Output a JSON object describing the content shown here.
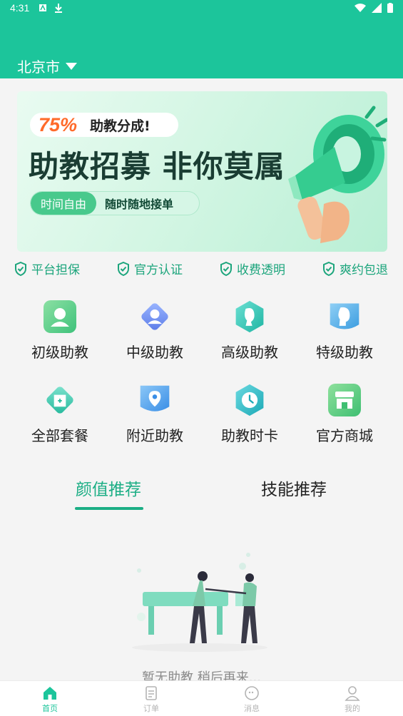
{
  "status_bar": {
    "time": "4:31"
  },
  "header": {
    "city": "北京市"
  },
  "banner": {
    "percent": "75%",
    "subtitle": "助教分成!",
    "title": "助教招募 非你莫属",
    "tag1": "时间自由",
    "tag2": "随时随地接单"
  },
  "guarantees": [
    "平台担保",
    "官方认证",
    "收费透明",
    "爽约包退"
  ],
  "categories": [
    {
      "label": "初级助教",
      "icon": "user-card-icon"
    },
    {
      "label": "中级助教",
      "icon": "female-avatar-icon"
    },
    {
      "label": "高级助教",
      "icon": "hair-profile-icon"
    },
    {
      "label": "特级助教",
      "icon": "face-profile-icon"
    },
    {
      "label": "全部套餐",
      "icon": "package-icon"
    },
    {
      "label": "附近助教",
      "icon": "location-pin-icon"
    },
    {
      "label": "助教时卡",
      "icon": "clock-icon"
    },
    {
      "label": "官方商城",
      "icon": "store-icon"
    }
  ],
  "tabs": {
    "active": "颜值推荐",
    "inactive": "技能推荐"
  },
  "empty_state": {
    "text": "暂无助教 稍后再来..."
  },
  "bottom_nav": [
    {
      "label": "首页",
      "icon": "home-icon",
      "active": true
    },
    {
      "label": "订单",
      "icon": "order-icon",
      "active": false
    },
    {
      "label": "消息",
      "icon": "message-icon",
      "active": false
    },
    {
      "label": "我的",
      "icon": "profile-icon",
      "active": false
    }
  ],
  "colors": {
    "primary": "#1cc59b",
    "accent_text": "#1cae85",
    "percent": "#ff6a2a"
  }
}
